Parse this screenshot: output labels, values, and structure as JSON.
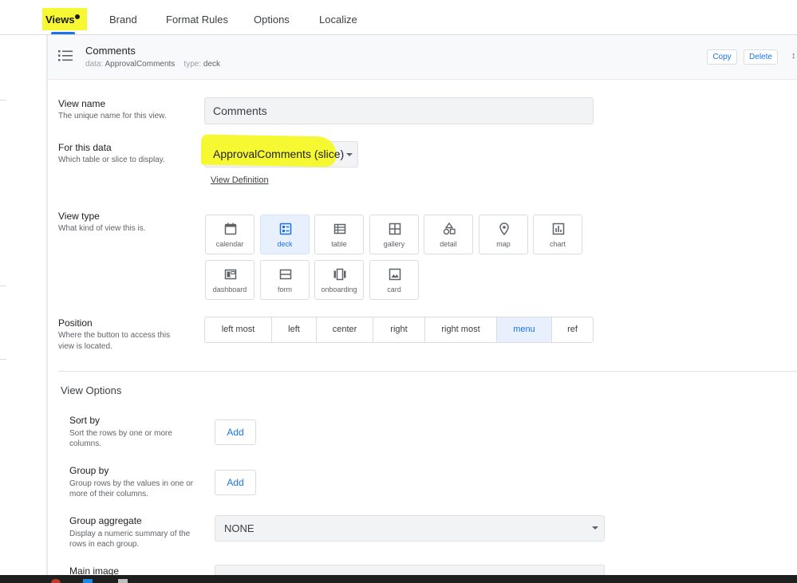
{
  "tabs": [
    {
      "label": "Views",
      "active": true
    },
    {
      "label": "Brand"
    },
    {
      "label": "Format Rules"
    },
    {
      "label": "Options"
    },
    {
      "label": "Localize"
    }
  ],
  "view_header": {
    "icon": "list-icon",
    "title": "Comments",
    "data_key": "data:",
    "data_value": "ApprovalComments",
    "type_key": "type:",
    "type_value": "deck",
    "copy_label": "Copy",
    "delete_label": "Delete"
  },
  "form": {
    "view_name": {
      "label": "View name",
      "description": "The unique name for this view.",
      "value": "Comments"
    },
    "for_this_data": {
      "label": "For this data",
      "description": "Which table or slice to display.",
      "value": "ApprovalComments (slice)",
      "link": "View Definition"
    },
    "view_type": {
      "label": "View type",
      "description": "What kind of view this is.",
      "selected": "deck",
      "options": [
        "calendar",
        "deck",
        "table",
        "gallery",
        "detail",
        "map",
        "chart",
        "dashboard",
        "form",
        "onboarding",
        "card"
      ]
    },
    "position": {
      "label": "Position",
      "description_line1": "Where the button to access this",
      "description_line2": "view is located.",
      "selected": "menu",
      "options": [
        "left most",
        "left",
        "center",
        "right",
        "right most",
        "menu",
        "ref"
      ]
    }
  },
  "view_options": {
    "title": "View Options",
    "sort_by": {
      "label": "Sort by",
      "description_line1": "Sort the rows by one or more",
      "description_line2": "columns.",
      "button": "Add"
    },
    "group_by": {
      "label": "Group by",
      "description_line1": "Group rows by the values in one or",
      "description_line2": "more of their columns.",
      "button": "Add"
    },
    "group_aggregate": {
      "label": "Group aggregate",
      "description_line1": "Display a numeric summary of the",
      "description_line2": "rows in each group.",
      "value": "NONE"
    },
    "main_image": {
      "label": "Main image"
    }
  },
  "colors": {
    "accent": "#1a73e8",
    "highlight": "#f6f832",
    "selected_bg": "#e8f0fe"
  }
}
